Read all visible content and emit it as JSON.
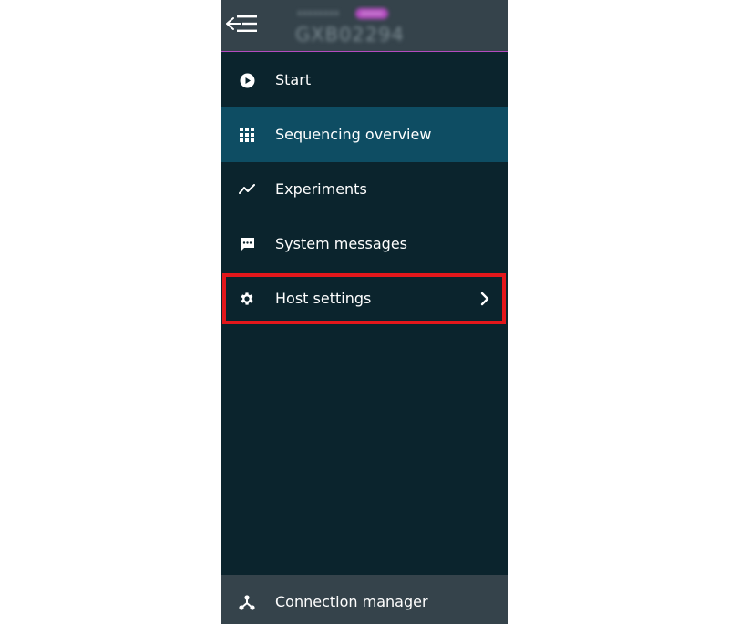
{
  "header": {
    "collapse_icon": "menu-collapse-icon",
    "device_label": "xxxxxxxx",
    "device_badge": "xxxxx",
    "device_id": "GXB02294"
  },
  "nav": {
    "items": [
      {
        "label": "Start",
        "icon": "play-circle-icon",
        "active": false
      },
      {
        "label": "Sequencing overview",
        "icon": "grid-icon",
        "active": true
      },
      {
        "label": "Experiments",
        "icon": "trend-line-icon",
        "active": false
      },
      {
        "label": "System messages",
        "icon": "message-icon",
        "active": false
      },
      {
        "label": "Host settings",
        "icon": "gear-icon",
        "active": false,
        "has_submenu": true,
        "highlighted": true
      }
    ]
  },
  "footer": {
    "label": "Connection manager",
    "icon": "network-icon"
  },
  "colors": {
    "panel_bg": "#0b242d",
    "header_bg": "#35434b",
    "active_bg": "#0e4d63",
    "accent": "#b34bbf",
    "highlight": "#e3171b"
  }
}
